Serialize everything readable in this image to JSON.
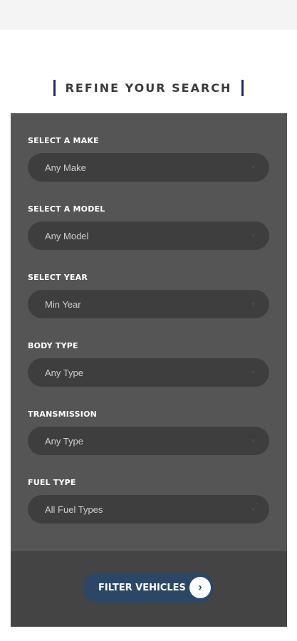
{
  "heading": "REFINE YOUR SEARCH",
  "fields": [
    {
      "label": "SELECT A MAKE",
      "value": "Any Make"
    },
    {
      "label": "SELECT A MODEL",
      "value": "Any Model"
    },
    {
      "label": "SELECT YEAR",
      "value": "Min Year"
    },
    {
      "label": "BODY TYPE",
      "value": "Any Type"
    },
    {
      "label": "TRANSMISSION",
      "value": "Any Type"
    },
    {
      "label": "FUEL TYPE",
      "value": "All Fuel Types"
    }
  ],
  "filter_button": {
    "label": "FILTER VEHICLES"
  },
  "icons": {
    "dropdown": "chevron-down-icon",
    "button": "chevron-right-icon"
  },
  "colors": {
    "panel": "#555555",
    "select": "#3e3e3e",
    "accent": "#2c4766",
    "heading_bar": "#1f2d5a"
  }
}
